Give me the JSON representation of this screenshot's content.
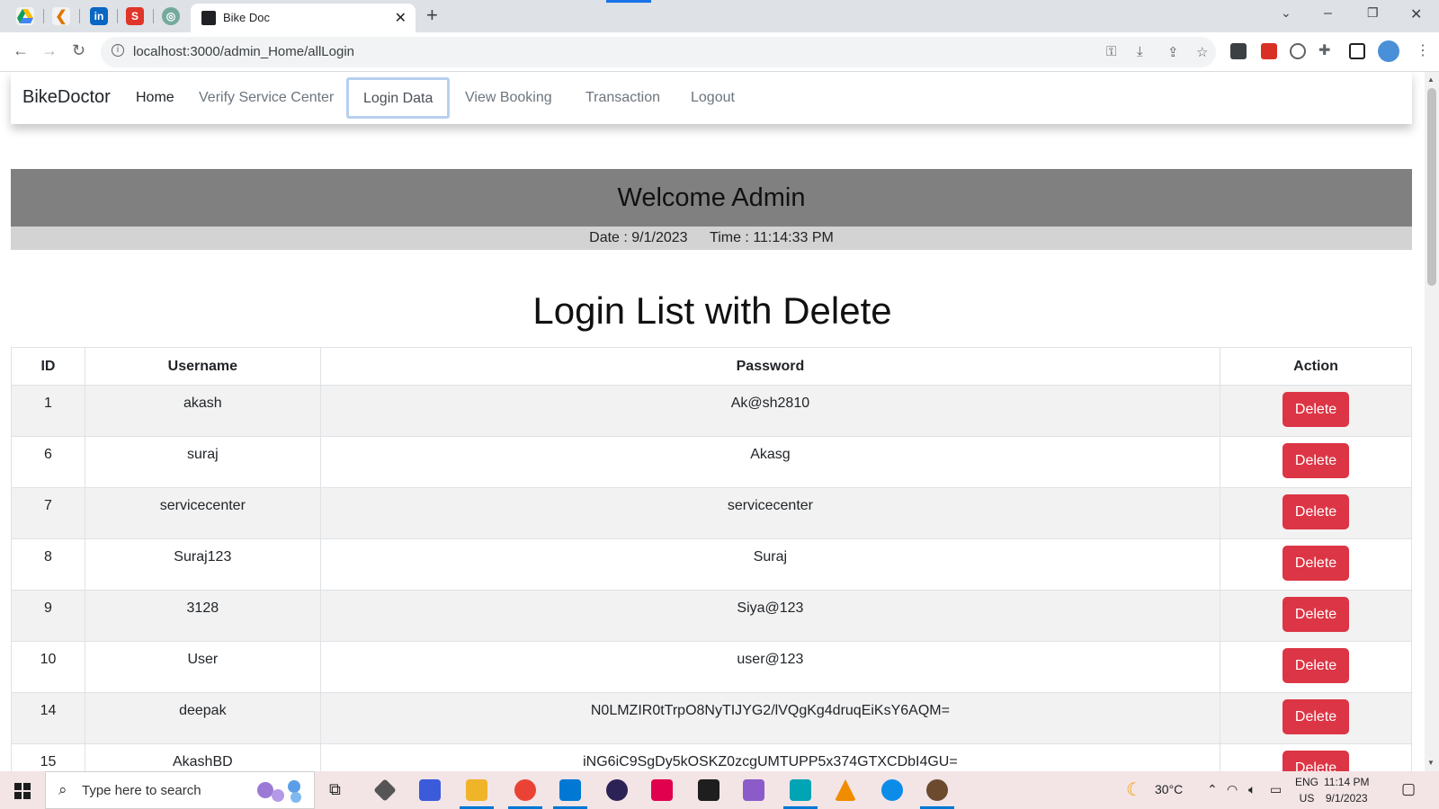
{
  "browser": {
    "active_tab_title": "Bike Doc",
    "url": "localhost:3000/admin_Home/allLogin"
  },
  "navbar": {
    "brand": "BikeDoctor",
    "links": [
      "Home",
      "Verify Service Center",
      "Login Data",
      "View Booking",
      "Transaction",
      "Logout"
    ],
    "active_link": "Login Data"
  },
  "banner": {
    "welcome": "Welcome Admin",
    "date_text": "Date : 9/1/2023",
    "time_text": "Time : 11:14:33 PM"
  },
  "login_list": {
    "title": "Login List with Delete",
    "columns": [
      "ID",
      "Username",
      "Password",
      "Action"
    ],
    "delete_label": "Delete",
    "rows": [
      {
        "id": "1",
        "username": "akash",
        "password": "Ak@sh2810"
      },
      {
        "id": "6",
        "username": "suraj",
        "password": "Akasg"
      },
      {
        "id": "7",
        "username": "servicecenter",
        "password": "servicecenter"
      },
      {
        "id": "8",
        "username": "Suraj123",
        "password": "Suraj"
      },
      {
        "id": "9",
        "username": "3128",
        "password": "Siya@123"
      },
      {
        "id": "10",
        "username": "User",
        "password": "user@123"
      },
      {
        "id": "14",
        "username": "deepak",
        "password": "N0LMZIR0tTrpO8NyTIJYG2/lVQgKg4druqEiKsY6AQM="
      },
      {
        "id": "15",
        "username": "AkashBD",
        "password": "iNG6iC9SgDy5kOSKZ0zcgUMTUPP5x374GTXCDbI4GU="
      }
    ]
  },
  "taskbar": {
    "search_placeholder": "Type here to search",
    "weather": "30°C",
    "lang_line1": "ENG",
    "lang_line2": "US",
    "time": "11:14 PM",
    "date": "9/1/2023"
  }
}
